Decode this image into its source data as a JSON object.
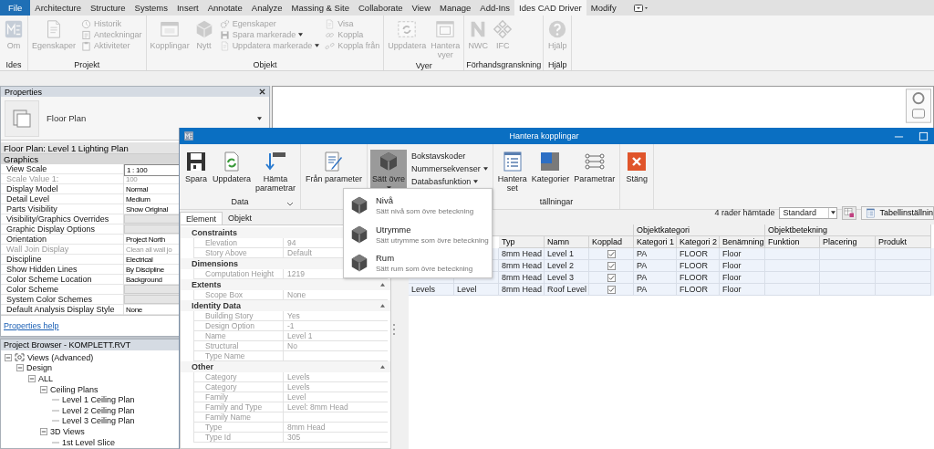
{
  "app_tabs": [
    {
      "label": "File",
      "kind": "file",
      "selected": false
    },
    {
      "label": "Architecture",
      "kind": "tab",
      "selected": false
    },
    {
      "label": "Structure",
      "kind": "tab",
      "selected": false
    },
    {
      "label": "Systems",
      "kind": "tab",
      "selected": false
    },
    {
      "label": "Insert",
      "kind": "tab",
      "selected": false
    },
    {
      "label": "Annotate",
      "kind": "tab",
      "selected": false
    },
    {
      "label": "Analyze",
      "kind": "tab",
      "selected": false
    },
    {
      "label": "Massing & Site",
      "kind": "tab",
      "selected": false
    },
    {
      "label": "Collaborate",
      "kind": "tab",
      "selected": false
    },
    {
      "label": "View",
      "kind": "tab",
      "selected": false
    },
    {
      "label": "Manage",
      "kind": "tab",
      "selected": false
    },
    {
      "label": "Add-Ins",
      "kind": "tab",
      "selected": false
    },
    {
      "label": "Ides CAD Driver",
      "kind": "tab",
      "selected": true
    },
    {
      "label": "Modify",
      "kind": "tab",
      "selected": false
    }
  ],
  "ribbon": [
    {
      "label": "Ides",
      "columns": [
        {
          "kind": "large",
          "tools": [
            {
              "label": "Om",
              "kind": "logo",
              "disabled": true
            }
          ]
        }
      ]
    },
    {
      "label": "Projekt",
      "columns": [
        {
          "kind": "large",
          "tools": [
            {
              "label": "Egenskaper",
              "kind": "doc",
              "disabled": true
            }
          ]
        },
        {
          "kind": "stack",
          "tools": [
            {
              "label": "Historik",
              "kind": "history",
              "disabled": true
            },
            {
              "label": "Anteckningar",
              "kind": "note",
              "disabled": true
            },
            {
              "label": "Aktiviteter",
              "kind": "clipboard",
              "disabled": true
            }
          ]
        }
      ]
    },
    {
      "label": "Objekt",
      "columns": [
        {
          "kind": "large",
          "tools": [
            {
              "label": "Kopplingar",
              "kind": "window",
              "disabled": true
            },
            {
              "label": "Nytt",
              "kind": "cube",
              "disabled": true
            }
          ]
        },
        {
          "kind": "stack",
          "tools": [
            {
              "label": "Egenskaper",
              "kind": "gears",
              "disabled": true
            },
            {
              "label": "Spara markerade",
              "kind": "save",
              "disabled": true,
              "dropdown": true
            },
            {
              "label": "Uppdatera markerade",
              "kind": "doc",
              "disabled": true,
              "dropdown": true
            }
          ]
        },
        {
          "kind": "stack",
          "tools": [
            {
              "label": "Visa",
              "kind": "doc",
              "disabled": true
            },
            {
              "label": "Koppla",
              "kind": "link",
              "disabled": true
            },
            {
              "label": "Koppla från",
              "kind": "unlink",
              "disabled": true
            }
          ]
        }
      ]
    },
    {
      "label": "Vyer",
      "columns": [
        {
          "kind": "large",
          "tools": [
            {
              "label": "Uppdatera",
              "kind": "refreshframe",
              "disabled": true
            },
            {
              "label": "Hantera\nvyer",
              "kind": "frame",
              "disabled": true
            }
          ]
        }
      ]
    },
    {
      "label": "Förhandsgranskning",
      "columns": [
        {
          "kind": "large",
          "tools": [
            {
              "label": "NWC",
              "kind": "zigzag",
              "disabled": true
            },
            {
              "label": "IFC",
              "kind": "diamonds",
              "disabled": true
            }
          ]
        }
      ]
    },
    {
      "label": "Hjälp",
      "columns": [
        {
          "kind": "large",
          "tools": [
            {
              "label": "Hjälp",
              "kind": "help",
              "disabled": true
            }
          ]
        }
      ]
    }
  ],
  "properties": {
    "title": "Properties",
    "type_name": "Floor Plan",
    "instance": "Floor Plan: Level 1 Lighting Plan",
    "group": "Graphics",
    "rows": [
      {
        "label": "View Scale",
        "value": "1 : 100",
        "kind": "field",
        "disabled": false
      },
      {
        "label": "Scale Value    1:",
        "value": "100",
        "kind": "text",
        "disabled": true
      },
      {
        "label": "Display Model",
        "value": "Normal",
        "kind": "text",
        "disabled": false
      },
      {
        "label": "Detail Level",
        "value": "Medium",
        "kind": "text",
        "disabled": false
      },
      {
        "label": "Parts Visibility",
        "value": "Show Original",
        "kind": "text",
        "disabled": false
      },
      {
        "label": "Visibility/Graphics Overrides",
        "kind": "button",
        "disabled": false
      },
      {
        "label": "Graphic Display Options",
        "kind": "button",
        "disabled": false
      },
      {
        "label": "Orientation",
        "value": "Project North",
        "kind": "text",
        "disabled": false
      },
      {
        "label": "Wall Join Display",
        "value": "Clean all wall jo",
        "kind": "text",
        "disabled": true
      },
      {
        "label": "Discipline",
        "value": "Electrical",
        "kind": "text",
        "disabled": false
      },
      {
        "label": "Show Hidden Lines",
        "value": "By Discipline",
        "kind": "text",
        "disabled": false
      },
      {
        "label": "Color Scheme Location",
        "value": "Background",
        "kind": "text",
        "disabled": false
      },
      {
        "label": "Color Scheme",
        "kind": "button",
        "disabled": false
      },
      {
        "label": "System Color Schemes",
        "kind": "button",
        "disabled": false
      },
      {
        "label": "Default Analysis Display Style",
        "value": "None",
        "kind": "text",
        "disabled": false
      }
    ],
    "help": "Properties help"
  },
  "project_browser": {
    "title": "Project Browser - KOMPLETT.RVT",
    "tree": [
      {
        "label": "Views (Advanced)",
        "expanded": true,
        "children": [
          {
            "label": "Design",
            "expanded": true,
            "children": [
              {
                "label": "ALL",
                "expanded": true,
                "children": [
                  {
                    "label": "Ceiling Plans",
                    "expanded": true,
                    "children": [
                      {
                        "label": "Level 1 Ceiling Plan"
                      },
                      {
                        "label": "Level 2 Ceiling Plan"
                      },
                      {
                        "label": "Level 3 Ceiling Plan"
                      }
                    ]
                  },
                  {
                    "label": "3D Views",
                    "expanded": true,
                    "children": [
                      {
                        "label": "1st Level Slice"
                      }
                    ]
                  }
                ]
              }
            ]
          }
        ]
      }
    ]
  },
  "dialog": {
    "title": "Hantera kopplingar",
    "ribbon": [
      {
        "label": "Data",
        "launcher": true,
        "columns": [
          {
            "kind": "large",
            "tools": [
              {
                "label": "Spara",
                "kind": "savedark",
                "pressed": false
              },
              {
                "label": "Uppdatera",
                "kind": "refresh",
                "pressed": false
              },
              {
                "label": "Hämta\nparametrar",
                "kind": "download",
                "pressed": false
              }
            ]
          }
        ]
      },
      {
        "columns": [
          {
            "kind": "large",
            "tools": [
              {
                "label": "Från parameter",
                "kind": "edit",
                "pressed": false
              }
            ]
          }
        ]
      },
      {
        "columns": [
          {
            "kind": "large",
            "tools": [
              {
                "label": "Sätt övre",
                "kind": "cubedark",
                "pressed": true,
                "dropdown": true
              }
            ]
          },
          {
            "kind": "stack",
            "tools": [
              {
                "label": "Bokstavskoder"
              },
              {
                "label": "Nummersekvenser",
                "dropdown": true
              },
              {
                "label": "Databasfunktion",
                "dropdown": true
              }
            ]
          }
        ]
      },
      {
        "label": "tällningar",
        "columns": [
          {
            "kind": "large",
            "tools": [
              {
                "label": "Hantera\nset",
                "kind": "list",
                "pressed": false
              },
              {
                "label": "Kategorier",
                "kind": "category",
                "pressed": false
              },
              {
                "label": "Parametrar",
                "kind": "params",
                "pressed": false
              }
            ]
          }
        ]
      },
      {
        "columns": [
          {
            "kind": "large",
            "tools": [
              {
                "label": "Stäng",
                "kind": "close",
                "pressed": false
              }
            ]
          }
        ]
      }
    ],
    "tabs": [
      {
        "label": "Element",
        "selected": true
      },
      {
        "label": "Objekt",
        "selected": false
      }
    ],
    "categories": [
      {
        "name": "Constraints",
        "rows": [
          {
            "label": "Elevation",
            "value": "94"
          },
          {
            "label": "Story Above",
            "value": "Default"
          }
        ]
      },
      {
        "name": "Dimensions",
        "rows": [
          {
            "label": "Computation Height",
            "value": "1219"
          }
        ]
      },
      {
        "name": "Extents",
        "expanded": true,
        "rows": [
          {
            "label": "Scope Box",
            "value": "None"
          }
        ]
      },
      {
        "name": "Identity Data",
        "expanded": true,
        "rows": [
          {
            "label": "Building Story",
            "value": "Yes"
          },
          {
            "label": "Design Option",
            "value": "-1"
          },
          {
            "label": "Name",
            "value": "Level 1"
          },
          {
            "label": "Structural",
            "value": "No"
          },
          {
            "label": "Type Name"
          }
        ]
      },
      {
        "name": "Other",
        "expanded": true,
        "rows": [
          {
            "label": "Category",
            "value": "Levels"
          },
          {
            "label": "Category",
            "value": "Levels"
          },
          {
            "label": "Family",
            "value": "Level"
          },
          {
            "label": "Family and Type",
            "value": "Level: 8mm Head"
          },
          {
            "label": "Family Name"
          },
          {
            "label": "Type",
            "value": "8mm Head"
          },
          {
            "label": "Type Id",
            "value": "305"
          }
        ]
      }
    ],
    "row_count": "4 rader hämtade",
    "view_select": "Standard",
    "table_settings": "Tabellinställnin",
    "table": {
      "column_groups": [
        {
          "columns": [
            null,
            null,
            "Typ",
            "Namn",
            "Kopplad"
          ]
        },
        {
          "label": "Objektkategori",
          "columns": [
            "Kategori 1",
            "Kategori 2",
            "Benämning"
          ]
        },
        {
          "label": "Objektbetekning",
          "columns": [
            "Funktion",
            "Placering",
            "Produkt"
          ]
        }
      ],
      "rows": [
        {
          "cells": [
            null,
            null,
            "8mm Head",
            "Level 1",
            {
              "checked": true
            },
            "PA",
            "FLOOR",
            "Floor",
            null,
            null,
            null
          ]
        },
        {
          "cells": [
            null,
            null,
            "8mm Head",
            "Level 2",
            {
              "checked": true
            },
            "PA",
            "FLOOR",
            "Floor",
            null,
            null,
            null
          ]
        },
        {
          "cells": [
            null,
            null,
            "8mm Head",
            "Level 3",
            {
              "checked": true
            },
            "PA",
            "FLOOR",
            "Floor",
            null,
            null,
            null
          ]
        },
        {
          "cells": [
            "Levels",
            "Level",
            "8mm Head",
            "Roof Level",
            {
              "checked": true
            },
            "PA",
            "FLOOR",
            "Floor",
            null,
            null,
            null
          ]
        }
      ]
    },
    "menu": [
      {
        "title": "Nivå",
        "description": "Sätt nivå som övre beteckning"
      },
      {
        "title": "Utrymme",
        "description": "Sätt utrymme som övre beteckning"
      },
      {
        "title": "Rum",
        "description": "Sätt rum som övre beteckning"
      }
    ]
  }
}
